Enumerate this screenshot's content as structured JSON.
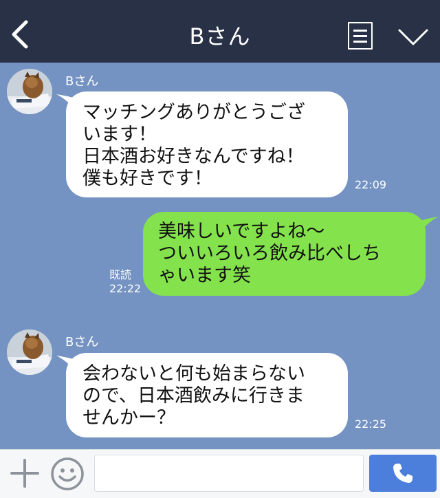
{
  "header": {
    "title": "Bさん",
    "back_icon": "chevron-left-icon",
    "menu_icon": "document-icon",
    "dropdown_icon": "chevron-down-icon",
    "background": "#283146"
  },
  "chat": {
    "background": "#7493c2",
    "messages": [
      {
        "sender": "Bさん",
        "direction": "incoming",
        "lines": [
          "マッチングありがとうござ",
          "います！",
          "日本酒お好きなんですね！",
          "僕も好きです！"
        ],
        "time": "22:09"
      },
      {
        "direction": "outgoing",
        "lines": [
          "美味しいですよね〜",
          "ついいろいろ飲み比べしち",
          "ゃいます笑"
        ],
        "read": "既読",
        "time": "22:22",
        "color": "#84e24c"
      },
      {
        "sender": "Bさん",
        "direction": "incoming",
        "lines": [
          "会わないと何も始まらない",
          "ので、日本酒飲みに行きま",
          "せんかー？"
        ],
        "time": "22:25"
      }
    ]
  },
  "footer": {
    "plus_icon": "plus-icon",
    "emoji_icon": "smiley-icon",
    "message_value": "",
    "call_icon": "phone-icon",
    "call_color": "#4c7fdb"
  }
}
